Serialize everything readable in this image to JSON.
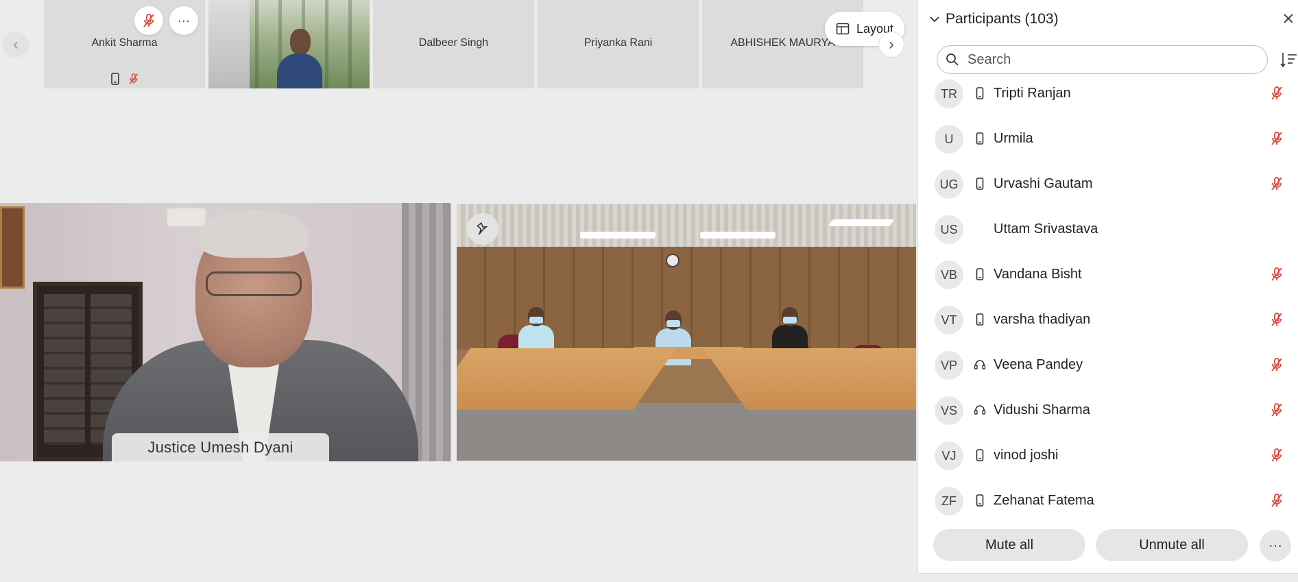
{
  "strip": {
    "thumbnails": [
      {
        "name": "Ankit Sharma"
      },
      {
        "name": ""
      },
      {
        "name": "Dalbeer Singh"
      },
      {
        "name": "Priyanka Rani"
      },
      {
        "name": "ABHISHEK MAURYA"
      }
    ],
    "prev_icon": "chevron-left-icon",
    "next_icon": "chevron-right-icon",
    "more_glyph": "···"
  },
  "layout_button": {
    "label": "Layout",
    "icon": "layout-icon"
  },
  "videos": {
    "speaker": {
      "name": "Justice Umesh Dyani"
    },
    "room": {
      "pin_icon": "pin-icon"
    }
  },
  "participants": {
    "title": "Participants (103)",
    "search_placeholder": "Search",
    "list": [
      {
        "initials": "TR",
        "name": "Tripti Ranjan",
        "device": "phone",
        "muted": true
      },
      {
        "initials": "U",
        "name": "Urmila",
        "device": "phone",
        "muted": true
      },
      {
        "initials": "UG",
        "name": "Urvashi Gautam",
        "device": "phone",
        "muted": true
      },
      {
        "initials": "US",
        "name": "Uttam Srivastava",
        "device": "none",
        "muted": false
      },
      {
        "initials": "VB",
        "name": "Vandana Bisht",
        "device": "phone",
        "muted": true
      },
      {
        "initials": "VT",
        "name": "varsha thadiyan",
        "device": "phone",
        "muted": true
      },
      {
        "initials": "VP",
        "name": "Veena Pandey",
        "device": "headset",
        "muted": true
      },
      {
        "initials": "VS",
        "name": "Vidushi Sharma",
        "device": "headset",
        "muted": true
      },
      {
        "initials": "VJ",
        "name": "vinod joshi",
        "device": "phone",
        "muted": true
      },
      {
        "initials": "ZF",
        "name": "Zehanat Fatema",
        "device": "phone",
        "muted": true
      }
    ],
    "mute_all": "Mute all",
    "unmute_all": "Unmute all",
    "more_glyph": "···"
  },
  "colors": {
    "muted_red": "#d9463a",
    "panel_bg": "#ffffff",
    "page_bg": "#ececec"
  }
}
